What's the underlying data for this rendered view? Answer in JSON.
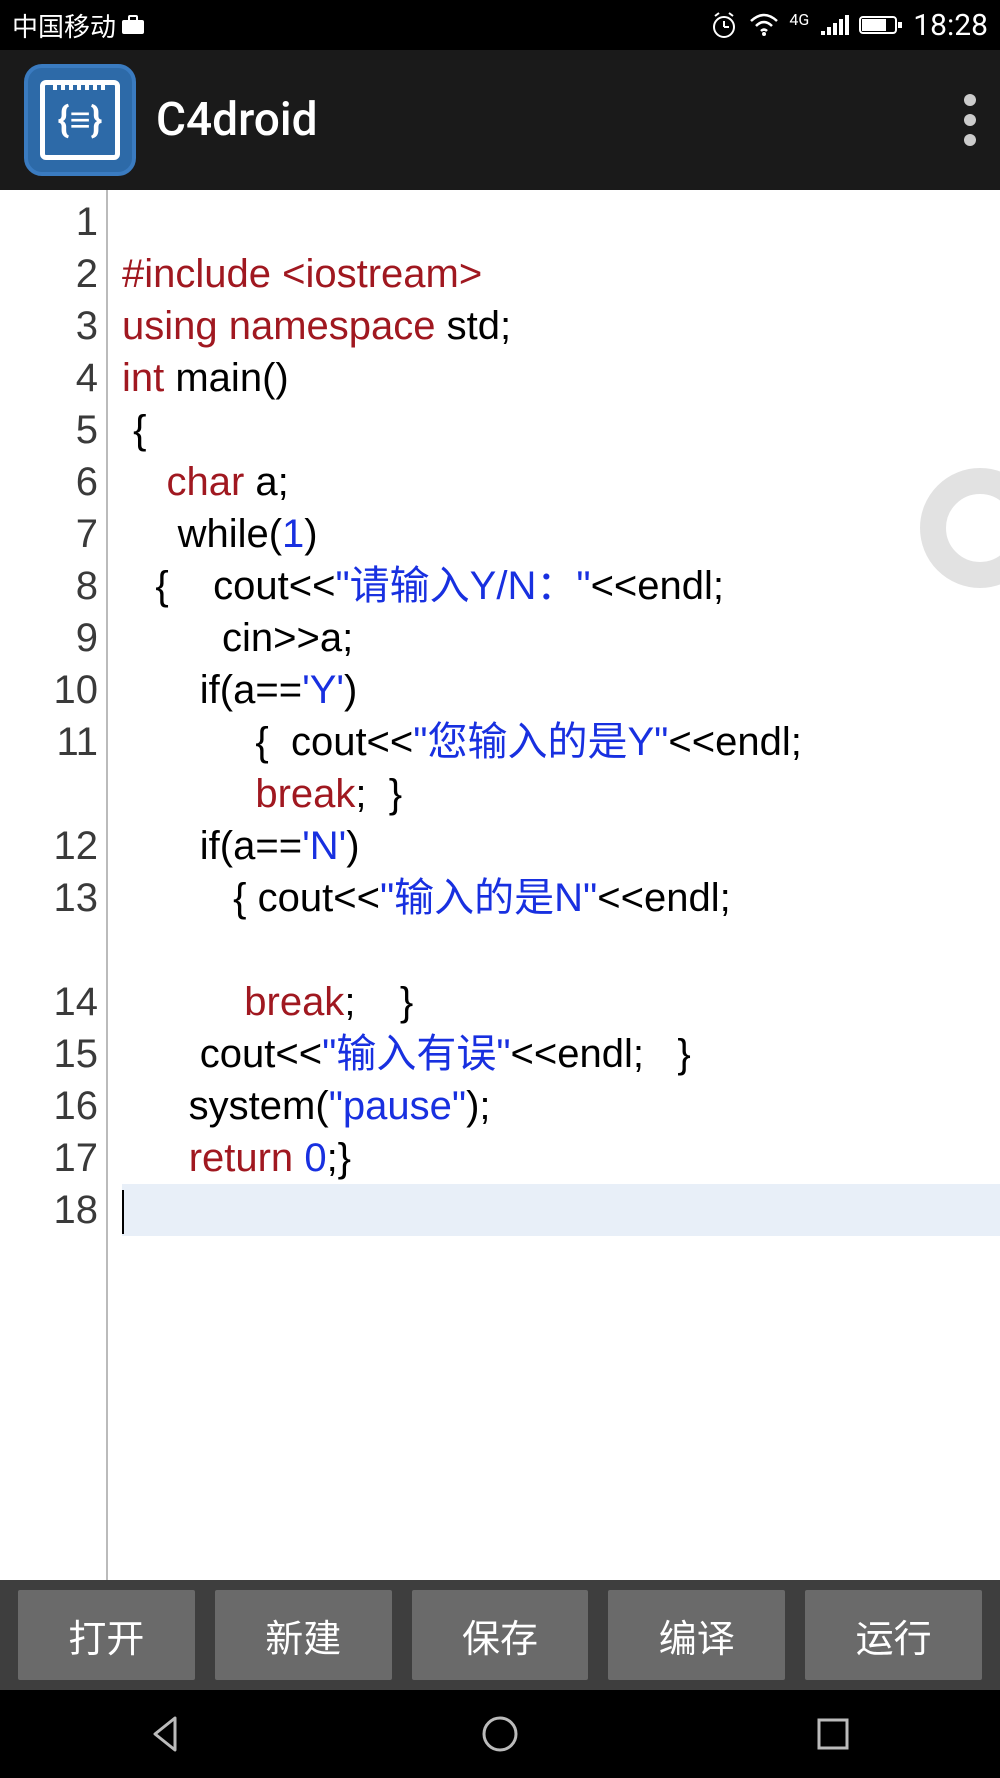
{
  "status": {
    "carrier": "中国移动",
    "time": "18:28",
    "network_label": "4G"
  },
  "app": {
    "title": "C4droid"
  },
  "editor": {
    "line_numbers": [
      "1",
      "2",
      "3",
      "4",
      "5",
      "6",
      "7",
      "8",
      "9",
      "10",
      "11",
      "12",
      "13",
      "14",
      "15",
      "16",
      "17",
      "18"
    ],
    "code_lines": [
      {
        "segments": [
          {
            "cls": "tk-plain",
            "text": ""
          }
        ]
      },
      {
        "segments": [
          {
            "cls": "tk-preproc",
            "text": "#include <iostream>"
          }
        ]
      },
      {
        "segments": [
          {
            "cls": "tk-keyword",
            "text": "using namespace"
          },
          {
            "cls": "tk-plain",
            "text": " std;"
          }
        ]
      },
      {
        "segments": [
          {
            "cls": "tk-type",
            "text": "int"
          },
          {
            "cls": "tk-plain",
            "text": " main()"
          }
        ]
      },
      {
        "segments": [
          {
            "cls": "tk-plain",
            "text": " {"
          }
        ]
      },
      {
        "segments": [
          {
            "cls": "tk-plain",
            "text": "    "
          },
          {
            "cls": "tk-type",
            "text": "char"
          },
          {
            "cls": "tk-plain",
            "text": " a;"
          }
        ]
      },
      {
        "segments": [
          {
            "cls": "tk-plain",
            "text": "     while("
          },
          {
            "cls": "tk-number",
            "text": "1"
          },
          {
            "cls": "tk-plain",
            "text": ")"
          }
        ]
      },
      {
        "segments": [
          {
            "cls": "tk-plain",
            "text": "   {    cout<<"
          },
          {
            "cls": "tk-string",
            "text": "\"请输入Y/N：\""
          },
          {
            "cls": "tk-plain",
            "text": "<<endl;"
          }
        ]
      },
      {
        "segments": [
          {
            "cls": "tk-plain",
            "text": "         cin>>a;"
          }
        ]
      },
      {
        "segments": [
          {
            "cls": "tk-plain",
            "text": "       if(a=="
          },
          {
            "cls": "tk-char",
            "text": "'Y'"
          },
          {
            "cls": "tk-plain",
            "text": ")"
          }
        ]
      },
      {
        "segments": [
          {
            "cls": "tk-plain",
            "text": "            {  cout<<"
          },
          {
            "cls": "tk-string",
            "text": "\"您输入的是Y\""
          },
          {
            "cls": "tk-plain",
            "text": "<<endl;"
          }
        ],
        "wrap": [
          {
            "segments": [
              {
                "cls": "tk-plain",
                "text": "            "
              },
              {
                "cls": "tk-keyword",
                "text": "break"
              },
              {
                "cls": "tk-plain",
                "text": ";  }"
              }
            ]
          }
        ]
      },
      {
        "segments": [
          {
            "cls": "tk-plain",
            "text": "       if(a=="
          },
          {
            "cls": "tk-char",
            "text": "'N'"
          },
          {
            "cls": "tk-plain",
            "text": ")"
          }
        ]
      },
      {
        "segments": [
          {
            "cls": "tk-plain",
            "text": "          { cout<<"
          },
          {
            "cls": "tk-string",
            "text": "\"输入的是N\""
          },
          {
            "cls": "tk-plain",
            "text": "<<endl;"
          }
        ],
        "wrap": [
          {
            "segments": [
              {
                "cls": "tk-plain",
                "text": ""
              }
            ]
          }
        ]
      },
      {
        "segments": [
          {
            "cls": "tk-plain",
            "text": "           "
          },
          {
            "cls": "tk-keyword",
            "text": "break"
          },
          {
            "cls": "tk-plain",
            "text": ";    }"
          }
        ]
      },
      {
        "segments": [
          {
            "cls": "tk-plain",
            "text": "       cout<<"
          },
          {
            "cls": "tk-string",
            "text": "\"输入有误\""
          },
          {
            "cls": "tk-plain",
            "text": "<<endl;   }"
          }
        ]
      },
      {
        "segments": [
          {
            "cls": "tk-plain",
            "text": "      system("
          },
          {
            "cls": "tk-string",
            "text": "\"pause\""
          },
          {
            "cls": "tk-plain",
            "text": ");"
          }
        ]
      },
      {
        "segments": [
          {
            "cls": "tk-plain",
            "text": "      "
          },
          {
            "cls": "tk-keyword",
            "text": "return"
          },
          {
            "cls": "tk-plain",
            "text": " "
          },
          {
            "cls": "tk-number",
            "text": "0"
          },
          {
            "cls": "tk-plain",
            "text": ";}"
          }
        ]
      },
      {
        "segments": [
          {
            "cls": "tk-plain",
            "text": ""
          }
        ],
        "current": true
      }
    ]
  },
  "toolbar": {
    "buttons": [
      "打开",
      "新建",
      "保存",
      "编译",
      "运行"
    ]
  }
}
